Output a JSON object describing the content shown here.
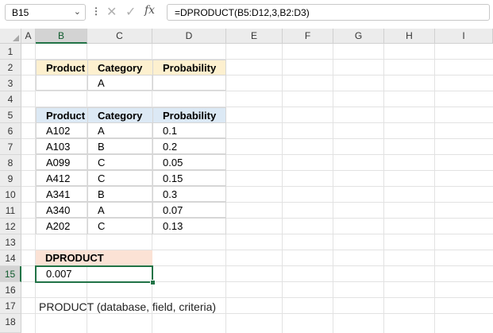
{
  "formula_bar": {
    "name_box": "B15",
    "dropdown_glyph": "⌄",
    "more_glyph": "⋮",
    "cancel_glyph": "✕",
    "enter_glyph": "✓",
    "fx_label": "fx",
    "formula": "=DPRODUCT(B5:D12,3,B2:D3)"
  },
  "columns": [
    "A",
    "B",
    "C",
    "D",
    "E",
    "F",
    "G",
    "H",
    "I"
  ],
  "rows": [
    "1",
    "2",
    "3",
    "4",
    "5",
    "6",
    "7",
    "8",
    "9",
    "10",
    "11",
    "12",
    "13",
    "14",
    "15",
    "16",
    "17",
    "18"
  ],
  "selected_cell": "B15",
  "criteria_table": {
    "headers": [
      "Product",
      "Category",
      "Probability"
    ],
    "values": [
      "",
      "A",
      ""
    ]
  },
  "database_table": {
    "headers": [
      "Product",
      "Category",
      "Probability"
    ],
    "rows": [
      [
        "A102",
        "A",
        "0.1"
      ],
      [
        "A103",
        "B",
        "0.2"
      ],
      [
        "A099",
        "C",
        "0.05"
      ],
      [
        "A412",
        "C",
        "0.15"
      ],
      [
        "A341",
        "B",
        "0.3"
      ],
      [
        "A340",
        "A",
        "0.07"
      ],
      [
        "A202",
        "C",
        "0.13"
      ]
    ]
  },
  "result": {
    "label": "DPRODUCT",
    "value": "0.007"
  },
  "syntax_text": "PRODUCT (database, field, criteria)",
  "colors": {
    "accent": "#217346",
    "criteria_header": "#fdf0cf",
    "database_header": "#dce9f5",
    "result_header": "#fbe2d5"
  }
}
